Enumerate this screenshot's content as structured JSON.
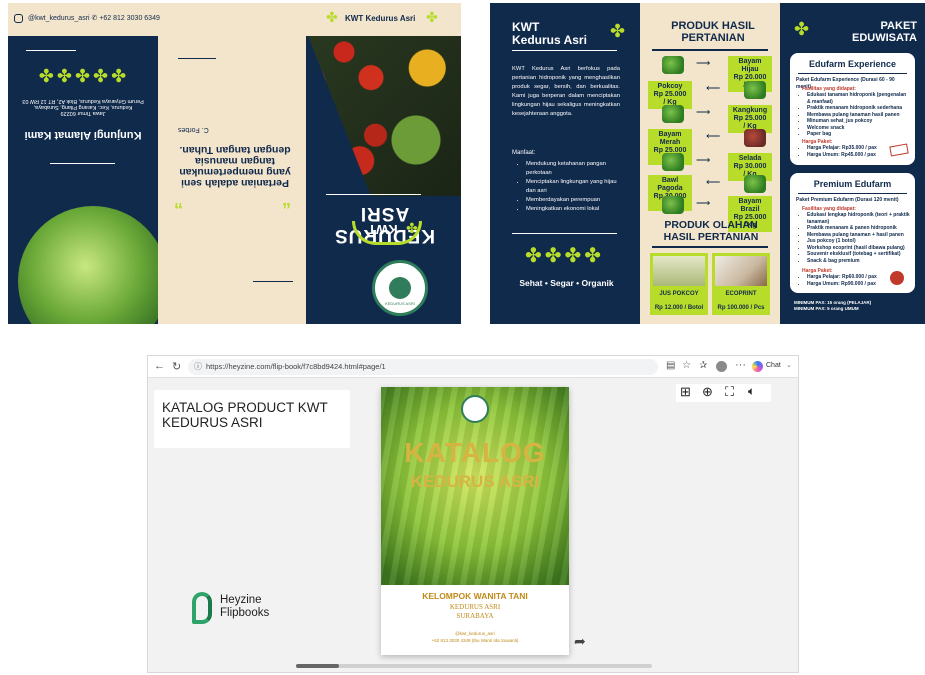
{
  "brochure_outside": {
    "top_bar": {
      "contact": "@kwt_kedurus_asri   ✆ +62 812 3030 6349",
      "brand": "KWT Kedurus Asri"
    },
    "visit_title": "Kunjungi Alamat Kami",
    "address_lines": [
      "Perum Griyaraya Kedurus, Blok A2, RT 12 RW 03",
      "Kedurus, Kec. Karang Pilang, Surabaya,",
      "Jawa Timur 60229"
    ],
    "quote": "Pertanian adalah seni yang mempertemukan tangan manusia dengan tangan Tuhan.",
    "quote_author": "C. Forbes",
    "cover_title": "KEDURUS ASRI",
    "cover_sub": "KWT",
    "seal_text": "KEDURUS ASRI"
  },
  "brochure_inside": {
    "left": {
      "title_line1": "KWT",
      "title_line2": "Kedurus Asri",
      "description": "KWT Kedurus Asri berfokus pada pertanian hidroponik yang menghasilkan produk segar, bersih, dan berkualitas. Kami juga berperan dalam menciptakan lingkungan hijau sekaligus meningkatkan kesejahteraan anggota.",
      "benefits_title": "Manfaat:",
      "benefits": [
        "Mendukung ketahanan pangan perkotaan",
        "Menciptakan lingkungan yang hijau dan asri",
        "Memberdayakan perempuan",
        "Meningkatkan ekonomi lokal"
      ],
      "tagline": "Sehat • Segar • Organik"
    },
    "middle": {
      "title": "PRODUK HASIL PERTANIAN",
      "products": [
        {
          "name": "Bayam Hijau",
          "price": "Rp 20.000 / Kg",
          "side": "right"
        },
        {
          "name": "Pokcoy",
          "price": "Rp 25.000 / Kg",
          "side": "left"
        },
        {
          "name": "Kangkung",
          "price": "Rp 25.000 / Kg",
          "side": "right"
        },
        {
          "name": "Bayam Merah",
          "price": "Rp 25.000 / Kg",
          "side": "left"
        },
        {
          "name": "Selada",
          "price": "Rp 30.000 / Kg",
          "side": "right"
        },
        {
          "name": "Bawl Pagoda",
          "price": "Rp 30.000 / Kg",
          "side": "left"
        },
        {
          "name": "Bayam Brazil",
          "price": "Rp 25.000 / Kg",
          "side": "right"
        }
      ],
      "processed_title": "PRODUK OLAHAN HASIL PERTANIAN",
      "processed": [
        {
          "name": "JUS POKCOY",
          "price": "Rp 12.000 / Botol"
        },
        {
          "name": "ECOPRINT",
          "price": "Rp 100.000 / Pcs"
        }
      ]
    },
    "right": {
      "title_line1": "PAKET",
      "title_line2": "EDUWISATA",
      "package1": {
        "title": "Edufarm Experience",
        "subtitle": "Paket Edufarm Experience (Durasi 60 - 90 menit)",
        "facilities_title": "Fasilitas yang didapat:",
        "facilities": [
          "Edukasi tanaman hidroponik (pengenalan & manfaat)",
          "Praktik menanam hidroponik sederhana",
          "Membawa pulang tanaman hasil panen",
          "Minuman sehat_jus pokcoy",
          "Welcome snack",
          "Paper bag"
        ],
        "price_title": "Harga Paket:",
        "prices": [
          "Harga Pelajar: Rp35.000 / pax",
          "Harga Umum: Rp45.000 / pax"
        ]
      },
      "package2": {
        "title": "Premium Edufarm",
        "subtitle": "Paket Premium Edufarm (Durasi 120 menit)",
        "facilities_title": "Fasilitas yang didapat:",
        "facilities": [
          "Edukasi lengkap hidroponik (teori + praktik tanaman)",
          "Praktik menanam & panen hidroponik",
          "Membawa pulang tanaman + hasil panen",
          "Jus pokcoy (1 botol)",
          "Workshop ecoprint (hasil dibawa pulang)",
          "Souvenir eksklusif (totebag + sertifikat)",
          "Snack & bag premium"
        ],
        "price_title": "Harga Paket:",
        "prices": [
          "Harga Pelajar: Rp60.000 / pax",
          "Harga Umum: Rp90.000 / pax"
        ]
      },
      "footer": [
        "MINIMUM PAX: 15 orang (PELAJAR)",
        "MINIMUM PAX: 5 orang UMUM"
      ]
    }
  },
  "browser": {
    "url": "https://heyzine.com/flip-book/f7c8bd9424.html#page/1",
    "chat_label": "Chat",
    "catalog_title": "KATALOG PRODUCT KWT KEDURUS ASRI",
    "heyzine_brand_line1": "Heyzine",
    "heyzine_brand_line2": "Flipbooks",
    "cover": {
      "title_line1": "KATALOG",
      "title_line2": "KEDURUS ASRI",
      "group": "KELOMPOK WANITA TANI",
      "name": "KEDURUS ASRI",
      "city": "SURABAYA",
      "contact1": "@kwt_kedurus_asri",
      "contact2": "+62 813 3030 4349 (Ibu Wanti Ida Suwanti)"
    },
    "scroll_progress": 0.12
  }
}
